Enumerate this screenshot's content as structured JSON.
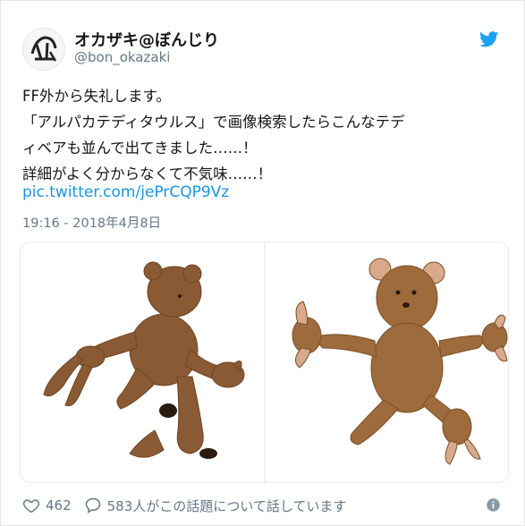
{
  "tweet": {
    "display_name": "オカザキ@ぼんじり",
    "handle": "@bon_okazaki",
    "text_lines": [
      "FF外から失礼します。",
      "「アルパカテディタウルス」で画像検索したらこんなテデ",
      "ィベアも並んで出てきました……！",
      "詳細がよく分からなくて不気味……！"
    ],
    "link": "pic.twitter.com/jePrCQP9Vz",
    "timestamp": "19:16 - 2018年4月8日",
    "likes": "462",
    "replies_text": "583人がこの話題について話しています"
  },
  "icons": {
    "avatar": "avatar-icon",
    "bird": "twitter-bird-icon",
    "like": "heart-icon",
    "reply": "speech-bubble-icon",
    "info": "info-icon"
  },
  "colors": {
    "link": "#1b95e0",
    "muted": "#657786",
    "text": "#14171a",
    "bird": "#1da1f2",
    "teddy": "#8a5a34",
    "teddy_light": "#b07a4a"
  }
}
